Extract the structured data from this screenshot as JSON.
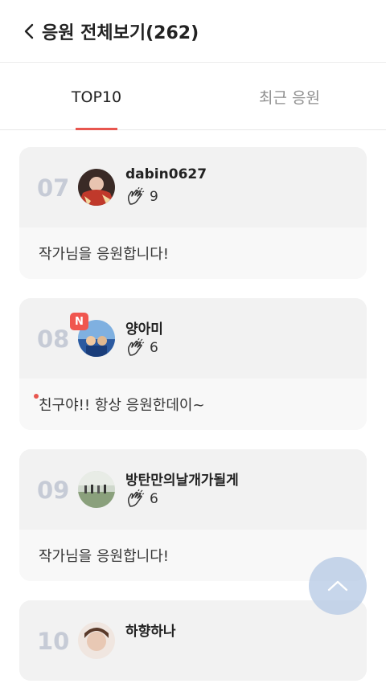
{
  "header": {
    "title": "응원 전체보기(262)"
  },
  "tabs": [
    {
      "label": "TOP10",
      "active": true
    },
    {
      "label": "최근 응원",
      "active": false
    }
  ],
  "cards": [
    {
      "rank": "07",
      "username": "dabin0627",
      "claps": "9",
      "message": "작가님을 응원합니다!",
      "new": false,
      "unread": false
    },
    {
      "rank": "08",
      "username": "양아미",
      "claps": "6",
      "message": "친구야!! 항상 응원한데이~",
      "new": true,
      "new_label": "N",
      "unread": true
    },
    {
      "rank": "09",
      "username": "방탄만의날개가될게",
      "claps": "6",
      "message": "작가님을 응원합니다!",
      "new": false,
      "unread": false
    },
    {
      "rank": "10",
      "username": "하향하나",
      "claps": "",
      "message": "",
      "new": false,
      "unread": false
    }
  ],
  "colors": {
    "accent": "#e8564f",
    "rank": "#c6cbd6",
    "fab": "#b4c8e4"
  }
}
